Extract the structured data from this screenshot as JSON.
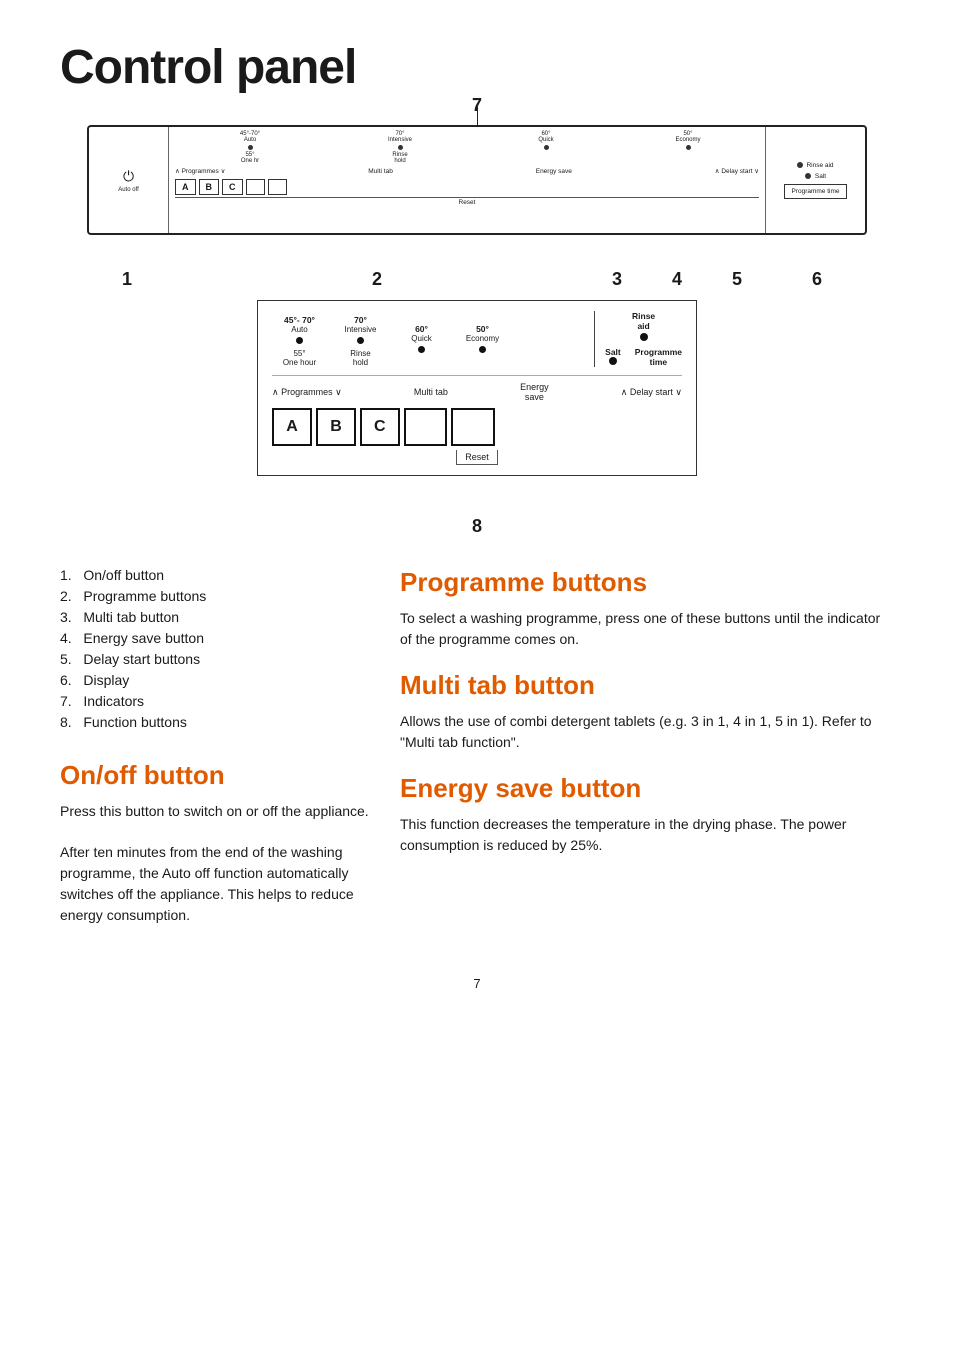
{
  "page": {
    "title": "Control panel",
    "number": "7"
  },
  "diagram": {
    "label7": "7",
    "label8": "8",
    "panel_numbers": [
      "1",
      "2",
      "3",
      "4",
      "5",
      "6"
    ],
    "auto_off": "Auto off",
    "power_symbol": "⏻",
    "reset_label": "Reset",
    "programmes_label": "∧  Programmes ∨",
    "multi_tab_label": "Multi tab",
    "energy_save_label": "Energy save",
    "delay_start_label": "∧  Delay start  ∨",
    "salt_label": "Salt",
    "rinse_aid_label": "Rinse aid",
    "programme_time_label": "Programme time"
  },
  "zoomed": {
    "prog1": {
      "top": "45°- 70°",
      "sub": "Auto",
      "dot": true,
      "bottom": "55°\nOne hour"
    },
    "prog2": {
      "top": "70°",
      "sub": "Intensive",
      "dot": true,
      "bottom": "Rinse\nhold"
    },
    "prog3": {
      "top": "60°",
      "sub": "Quick",
      "dot": true,
      "bottom": ""
    },
    "prog4": {
      "top": "50°",
      "sub": "Economy",
      "dot": true,
      "bottom": ""
    },
    "rinse_aid": "Rinse\naid",
    "rinse_dot": true,
    "salt": "Salt",
    "salt_dot": true,
    "programme_time": "Programme\ntime",
    "programmes_ctrl": "∧  Programmes ∨",
    "multi_tab_ctrl": "Multi tab",
    "energy_save_ctrl": "Energy\nsave",
    "delay_start_ctrl": "∧  Delay start  ∨",
    "btn_a": "A",
    "btn_b": "B",
    "btn_c": "C",
    "reset": "Reset"
  },
  "numbered_list": {
    "items": [
      {
        "num": "1.",
        "text": "On/off button"
      },
      {
        "num": "2.",
        "text": "Programme buttons"
      },
      {
        "num": "3.",
        "text": "Multi tab button"
      },
      {
        "num": "4.",
        "text": "Energy save button"
      },
      {
        "num": "5.",
        "text": "Delay start buttons"
      },
      {
        "num": "6.",
        "text": "Display"
      },
      {
        "num": "7.",
        "text": "Indicators"
      },
      {
        "num": "8.",
        "text": "Function buttons"
      }
    ]
  },
  "sections": {
    "onoff": {
      "heading": "On/off button",
      "paragraphs": [
        "Press this button to switch on or off the appliance.",
        "After ten minutes from the end of the washing programme, the Auto off function automatically switches off the appliance. This helps to reduce energy consumption."
      ]
    },
    "programme": {
      "heading": "Programme buttons",
      "text": "To select a washing programme, press one of these buttons until the indicator of the programme comes on."
    },
    "multitab": {
      "heading": "Multi tab button",
      "text": "Allows the use of combi detergent tablets (e.g. 3 in 1, 4 in 1, 5 in 1). Refer to \"Multi tab function\"."
    },
    "energysave": {
      "heading": "Energy save button",
      "text": "This function decreases the temperature in the drying phase. The power consumption is reduced by 25%."
    }
  },
  "colors": {
    "accent": "#e05a00",
    "text": "#1a1a1a",
    "border": "#333"
  }
}
